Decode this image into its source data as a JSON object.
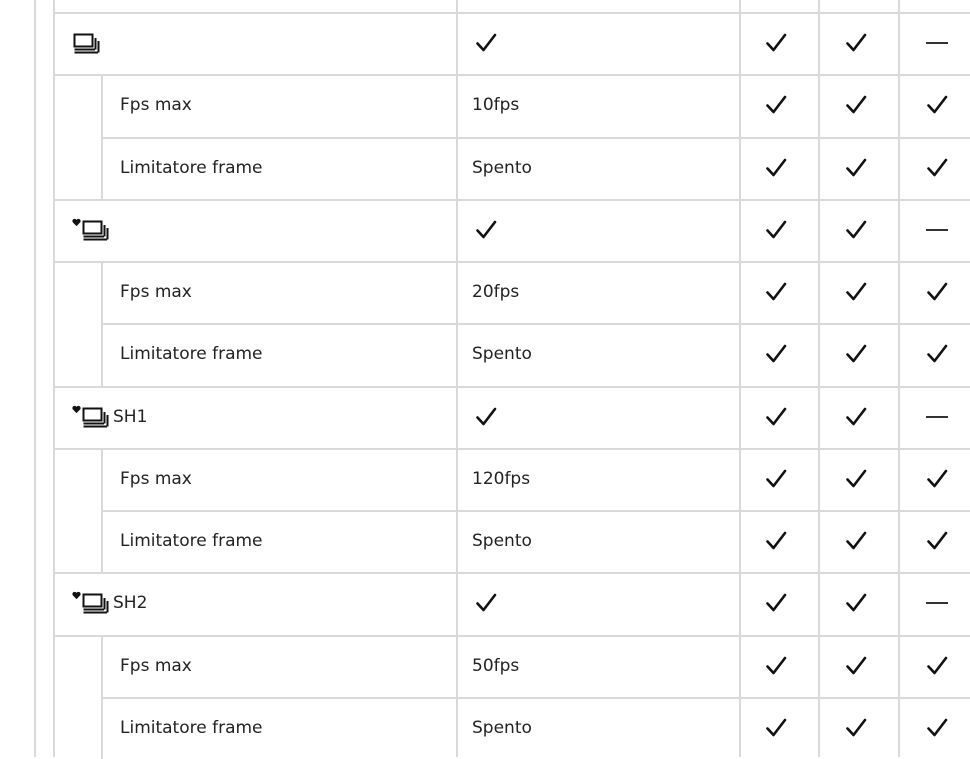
{
  "table": {
    "groups": [
      {
        "mode": {
          "icon": "sequential-shooting-icon",
          "prefix_icon": null,
          "suffix": ""
        },
        "value_check": true,
        "cols": [
          "check",
          "check",
          "dash"
        ],
        "subrows": [
          {
            "label": "Fps max",
            "value": "10fps",
            "cols": [
              "check",
              "check",
              "check"
            ]
          },
          {
            "label": "Limitatore frame",
            "value": "Spento",
            "cols": [
              "check",
              "check",
              "check"
            ]
          }
        ]
      },
      {
        "mode": {
          "icon": "sequential-shooting-icon",
          "prefix_icon": "silent-heart-icon",
          "suffix": ""
        },
        "value_check": true,
        "cols": [
          "check",
          "check",
          "dash"
        ],
        "subrows": [
          {
            "label": "Fps max",
            "value": "20fps",
            "cols": [
              "check",
              "check",
              "check"
            ]
          },
          {
            "label": "Limitatore frame",
            "value": "Spento",
            "cols": [
              "check",
              "check",
              "check"
            ]
          }
        ]
      },
      {
        "mode": {
          "icon": "sequential-shooting-icon",
          "prefix_icon": "silent-heart-icon",
          "suffix": "SH1"
        },
        "value_check": true,
        "cols": [
          "check",
          "check",
          "dash"
        ],
        "subrows": [
          {
            "label": "Fps max",
            "value": "120fps",
            "cols": [
              "check",
              "check",
              "check"
            ]
          },
          {
            "label": "Limitatore frame",
            "value": "Spento",
            "cols": [
              "check",
              "check",
              "check"
            ]
          }
        ]
      },
      {
        "mode": {
          "icon": "sequential-shooting-icon",
          "prefix_icon": "silent-heart-icon",
          "suffix": "SH2"
        },
        "value_check": true,
        "cols": [
          "check",
          "check",
          "dash"
        ],
        "subrows": [
          {
            "label": "Fps max",
            "value": "50fps",
            "cols": [
              "check",
              "check",
              "check"
            ]
          },
          {
            "label": "Limitatore frame",
            "value": "Spento",
            "cols": [
              "check",
              "check",
              "check"
            ]
          }
        ]
      }
    ]
  }
}
